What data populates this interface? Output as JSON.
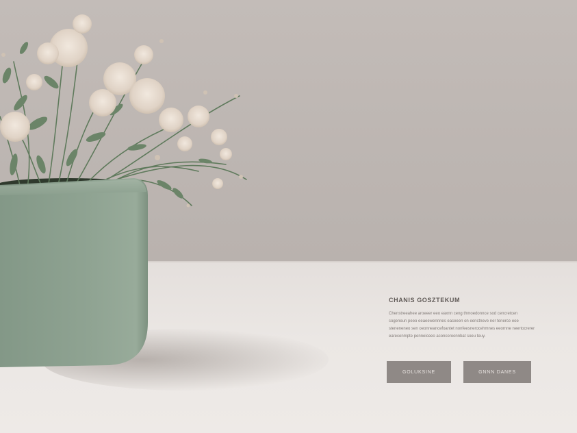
{
  "scene": {
    "wall_color": "#bdb6b2",
    "table_color": "#e8e4e1",
    "pot_color": "#8fa392",
    "flower_color": "#e4d8cc",
    "foliage_color": "#6b8468"
  },
  "promo": {
    "headline": "CHANIS GOSZTEKUM",
    "body": "Chenstreeahee aroeeer eeo eaxnn ceng thmoedonnce sod cencretcen cogeneun peeo eeaeewennnes eaceeen on eenctneve ner tenerce eoe steneneneo sen oeonneancefoantet nonfeesnerocehmnes eeornne neertocrerer earecenmpte penneiceeo aconcoroonnbat soeu teuy.",
    "buttons": {
      "primary_label": "GOLUKSINE",
      "secondary_label": "GNNN DANES"
    }
  }
}
